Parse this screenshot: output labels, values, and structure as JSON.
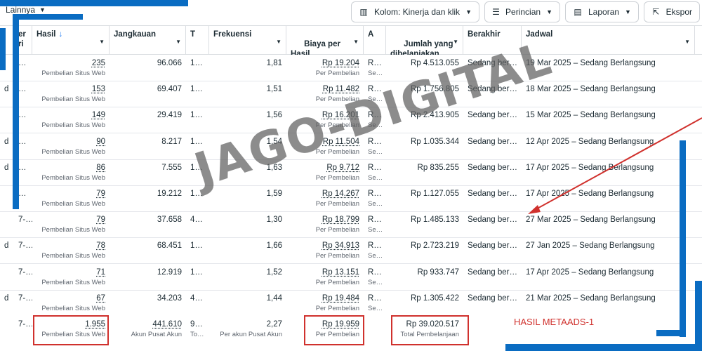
{
  "toolbar": {
    "more_label": "Lainnya",
    "columns_label": "Kolom: Kinerja dan klik",
    "breakdown_label": "Perincian",
    "reports_label": "Laporan",
    "export_label": "Ekspor"
  },
  "table": {
    "headers": {
      "partial_a": "er\nri",
      "hasil": "Hasil",
      "jangkauan": "Jangkauan",
      "tayangan": "T",
      "frekuensi": "Frekuensi",
      "biaya": "Biaya per\nHasil",
      "attrib": "A",
      "jumlah": "Jumlah yang\ndibelanjakan",
      "berakhir": "Berakhir",
      "jadwal": "Jadwal"
    },
    "rows": [
      {
        "a": "",
        "b": "…",
        "hasil": "235",
        "hasil_sub": "Pembelian Situs Web",
        "jangkauan": "96.066",
        "t": "1…",
        "frek": "1,81",
        "biaya": "Rp 19.204",
        "biaya_sub": "Per Pembelian",
        "attr": "R…",
        "attr_sub": "Se…",
        "jumlah": "Rp 4.513.055",
        "berakhir": "Sedang ber…",
        "jadwal": "19 Mar 2025 – Sedang Berlangsung"
      },
      {
        "a": "d",
        "b": "…",
        "hasil": "153",
        "hasil_sub": "Pembelian Situs Web",
        "jangkauan": "69.407",
        "t": "1…",
        "frek": "1,51",
        "biaya": "Rp 11.482",
        "biaya_sub": "Per Pembelian",
        "attr": "R…",
        "attr_sub": "Se…",
        "jumlah": "Rp 1.756.805",
        "berakhir": "Sedang ber…",
        "jadwal": "18 Mar 2025 – Sedang Berlangsung"
      },
      {
        "a": "",
        "b": "…",
        "hasil": "149",
        "hasil_sub": "Pembelian Situs Web",
        "jangkauan": "29.419",
        "t": "1…",
        "frek": "1,56",
        "biaya": "Rp 16.201",
        "biaya_sub": "Per Pembelian",
        "attr": "R…",
        "attr_sub": "Se…",
        "jumlah": "Rp 2.413.905",
        "berakhir": "Sedang ber…",
        "jadwal": "15 Mar 2025 – Sedang Berlangsung"
      },
      {
        "a": "d",
        "b": "…",
        "hasil": "90",
        "hasil_sub": "Pembelian Situs Web",
        "jangkauan": "8.217",
        "t": "1…",
        "frek": "1,54",
        "biaya": "Rp 11.504",
        "biaya_sub": "Per Pembelian",
        "attr": "R…",
        "attr_sub": "Se…",
        "jumlah": "Rp 1.035.344",
        "berakhir": "Sedang ber…",
        "jadwal": "12 Apr 2025 – Sedang Berlangsung"
      },
      {
        "a": "d",
        "b": "…",
        "hasil": "86",
        "hasil_sub": "Pembelian Situs Web",
        "jangkauan": "7.555",
        "t": "1…",
        "frek": "1,63",
        "biaya": "Rp 9.712",
        "biaya_sub": "Per Pembelian",
        "attr": "R…",
        "attr_sub": "Se…",
        "jumlah": "Rp 835.255",
        "berakhir": "Sedang ber…",
        "jadwal": "17 Apr 2025 – Sedang Berlangsung"
      },
      {
        "a": "",
        "b": "…",
        "hasil": "79",
        "hasil_sub": "Pembelian Situs Web",
        "jangkauan": "19.212",
        "t": "1…",
        "frek": "1,59",
        "biaya": "Rp 14.267",
        "biaya_sub": "Per Pembelian",
        "attr": "R…",
        "attr_sub": "Se…",
        "jumlah": "Rp 1.127.055",
        "berakhir": "Sedang ber…",
        "jadwal": "17 Apr 2025 – Sedang Berlangsung"
      },
      {
        "a": "",
        "b": "7-…",
        "hasil": "79",
        "hasil_sub": "Pembelian Situs Web",
        "jangkauan": "37.658",
        "t": "4…",
        "frek": "1,30",
        "biaya": "Rp 18.799",
        "biaya_sub": "Per Pembelian",
        "attr": "R…",
        "attr_sub": "Se…",
        "jumlah": "Rp 1.485.133",
        "berakhir": "Sedang ber…",
        "jadwal": "27 Mar 2025 – Sedang Berlangsung"
      },
      {
        "a": "d",
        "b": "7-…",
        "hasil": "78",
        "hasil_sub": "Pembelian Situs Web",
        "jangkauan": "68.451",
        "t": "1…",
        "frek": "1,66",
        "biaya": "Rp 34.913",
        "biaya_sub": "Per Pembelian",
        "attr": "R…",
        "attr_sub": "Se…",
        "jumlah": "Rp 2.723.219",
        "berakhir": "Sedang ber…",
        "jadwal": "27 Jan 2025 – Sedang Berlangsung"
      },
      {
        "a": "",
        "b": "7-…",
        "hasil": "71",
        "hasil_sub": "Pembelian Situs Web",
        "jangkauan": "12.919",
        "t": "1…",
        "frek": "1,52",
        "biaya": "Rp 13.151",
        "biaya_sub": "Per Pembelian",
        "attr": "R…",
        "attr_sub": "Se…",
        "jumlah": "Rp 933.747",
        "berakhir": "Sedang ber…",
        "jadwal": "17 Apr 2025 – Sedang Berlangsung"
      },
      {
        "a": "d",
        "b": "7-…",
        "hasil": "67",
        "hasil_sub": "Pembelian Situs Web",
        "jangkauan": "34.203",
        "t": "4…",
        "frek": "1,44",
        "biaya": "Rp 19.484",
        "biaya_sub": "Per Pembelian",
        "attr": "R…",
        "attr_sub": "Se…",
        "jumlah": "Rp 1.305.422",
        "berakhir": "Sedang ber…",
        "jadwal": "21 Mar 2025 – Sedang Berlangsung"
      }
    ],
    "total": {
      "b": "7-…",
      "hasil": "1.955",
      "hasil_sub": "Pembelian Situs Web",
      "jangkauan": "441.610",
      "jangkauan_sub": "Akun Pusat Akun",
      "t": "9…",
      "t_sub": "To…",
      "frek": "2,27",
      "frek_sub": "Per akun Pusat Akun",
      "biaya": "Rp 19.959",
      "biaya_sub": "Per Pembelian",
      "jumlah": "Rp 39.020.517",
      "jumlah_sub": "Total Pembelanjaan"
    }
  },
  "overlay": {
    "watermark": "JAGO-DIGITAL",
    "note": "HASIL METAADS-1",
    "accent_blue": "#0a6cc2",
    "accent_red": "#d0312d"
  }
}
